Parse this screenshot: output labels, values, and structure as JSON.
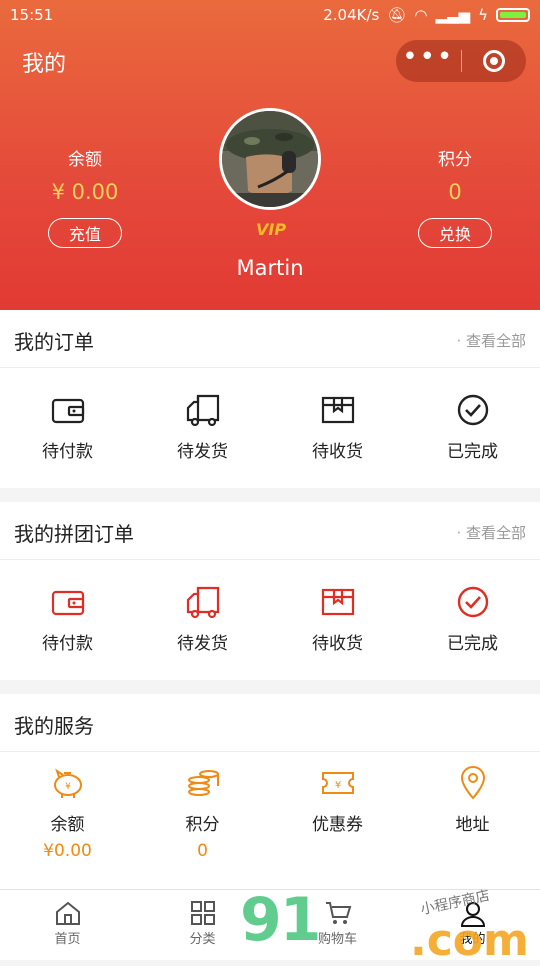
{
  "status": {
    "time": "15:51",
    "speed": "2.04K/s"
  },
  "header": {
    "title": "我的"
  },
  "balance": {
    "label": "余额",
    "value": "¥ 0.00",
    "button": "充值"
  },
  "points": {
    "label": "积分",
    "value": "0",
    "button": "兑换"
  },
  "user": {
    "name": "Martin",
    "badge": "VIP"
  },
  "orders": {
    "title": "我的订单",
    "more": "查看全部",
    "items": [
      {
        "label": "待付款",
        "icon": "wallet-icon"
      },
      {
        "label": "待发货",
        "icon": "truck-icon"
      },
      {
        "label": "待收货",
        "icon": "box-icon"
      },
      {
        "label": "已完成",
        "icon": "check-circle-icon"
      }
    ]
  },
  "group_orders": {
    "title": "我的拼团订单",
    "more": "查看全部",
    "items": [
      {
        "label": "待付款",
        "icon": "wallet-icon"
      },
      {
        "label": "待发货",
        "icon": "truck-icon"
      },
      {
        "label": "待收货",
        "icon": "box-icon"
      },
      {
        "label": "已完成",
        "icon": "check-circle-icon"
      }
    ]
  },
  "services": {
    "title": "我的服务",
    "items": [
      {
        "label": "余额",
        "value": "¥0.00",
        "icon": "piggy-bank-icon"
      },
      {
        "label": "积分",
        "value": "0",
        "icon": "coins-icon"
      },
      {
        "label": "优惠券",
        "icon": "coupon-icon"
      },
      {
        "label": "地址",
        "icon": "location-pin-icon"
      }
    ]
  },
  "tabbar": [
    {
      "label": "首页",
      "icon": "home-icon"
    },
    {
      "label": "分类",
      "icon": "grid-icon"
    },
    {
      "label": "购物车",
      "icon": "cart-icon"
    },
    {
      "label": "我的",
      "icon": "user-icon"
    }
  ],
  "watermark": {
    "big": "91",
    "com": ".com",
    "shop": "小程序商店"
  },
  "colors": {
    "header_top": "#ea6a3d",
    "header_bottom": "#e23a34",
    "accent_gold": "#fbd15c",
    "group_red": "#e02e24",
    "service_orange": "#f08a12"
  }
}
